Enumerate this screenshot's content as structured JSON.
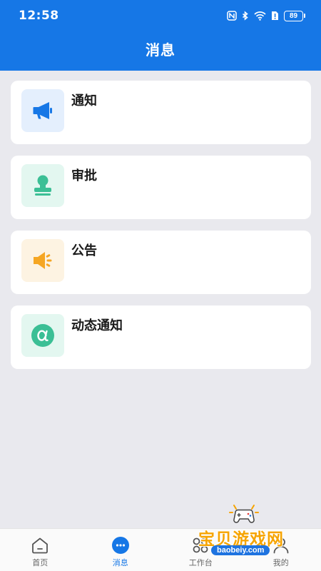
{
  "status_bar": {
    "time": "12:58",
    "battery": "89"
  },
  "header": {
    "title": "消息"
  },
  "messages": [
    {
      "label": "通知",
      "icon": "megaphone-icon",
      "bg": "#e4effd",
      "color": "#1677e6"
    },
    {
      "label": "审批",
      "icon": "stamp-icon",
      "bg": "#e3f7f0",
      "color": "#3bbf95"
    },
    {
      "label": "公告",
      "icon": "speaker-icon",
      "bg": "#fdf3e2",
      "color": "#f5a623"
    },
    {
      "label": "动态通知",
      "icon": "alpha-icon",
      "bg": "#e3f7f0",
      "color": "#3bbf95"
    }
  ],
  "tabbar": {
    "active": 1,
    "tabs": [
      {
        "label": "首页",
        "icon": "home-icon"
      },
      {
        "label": "消息",
        "icon": "chat-icon"
      },
      {
        "label": "工作台",
        "icon": "grid-icon"
      },
      {
        "label": "我的",
        "icon": "user-icon"
      }
    ]
  },
  "watermark": {
    "text": "宝贝游戏网",
    "url": "baobeiy.com"
  },
  "colors": {
    "primary": "#1677e6",
    "background": "#e9e9ee"
  }
}
